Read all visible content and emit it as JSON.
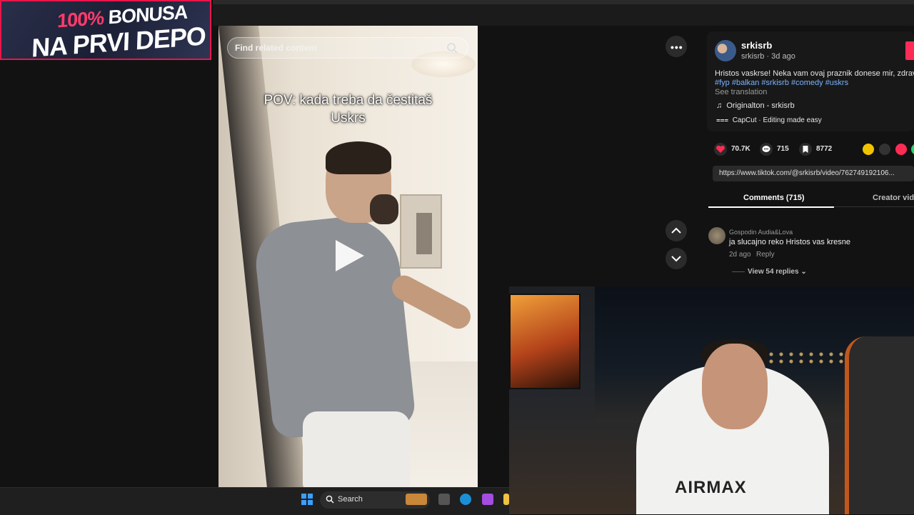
{
  "promo": {
    "line1_pct": "100%",
    "line1_rest": " BONUSA",
    "line2": "NA PRVI DEPO"
  },
  "video": {
    "search_placeholder": "Find related content",
    "caption_line1": "POV: kada treba da čestitaš",
    "caption_line2": "Uskrs"
  },
  "author": {
    "username": "srkisrb",
    "handle": "srkisrb",
    "posted": "3d ago",
    "description": "Hristos vaskrse! Neka vam ovaj praznik donese mir, zdravlje i r",
    "tags": "#fyp #balkan #srkisrb #comedy #uskrs",
    "see_translation": "See translation",
    "music": "Originalton - srkisrb",
    "capcut": "CapCut · Editing made easy"
  },
  "stats": {
    "likes": "70.7K",
    "comments": "715",
    "saves": "8772"
  },
  "link": "https://www.tiktok.com/@srkisrb/video/762749192106...",
  "tabs": {
    "comments": "Comments (715)",
    "creator": "Creator vide"
  },
  "comment": {
    "name": "Gospodin Audia&Lova",
    "text": "ja slucajno reko Hristos vas kresne",
    "time": "2d ago",
    "reply": "Reply",
    "view_replies": "View 54 replies"
  },
  "webcam": {
    "shirt_text": "AIRMAX"
  },
  "taskbar": {
    "search_label": "Search"
  },
  "colors": {
    "accent": "#fe2c55",
    "hashtag": "#7ab3ff",
    "promo_border": "#e8164a"
  },
  "icons": [
    "more-icon",
    "chevron-up-icon",
    "chevron-down-icon",
    "heart-icon",
    "comment-icon",
    "bookmark-icon",
    "music-note-icon",
    "capcut-icon",
    "play-icon",
    "search-icon",
    "windows-icon"
  ]
}
